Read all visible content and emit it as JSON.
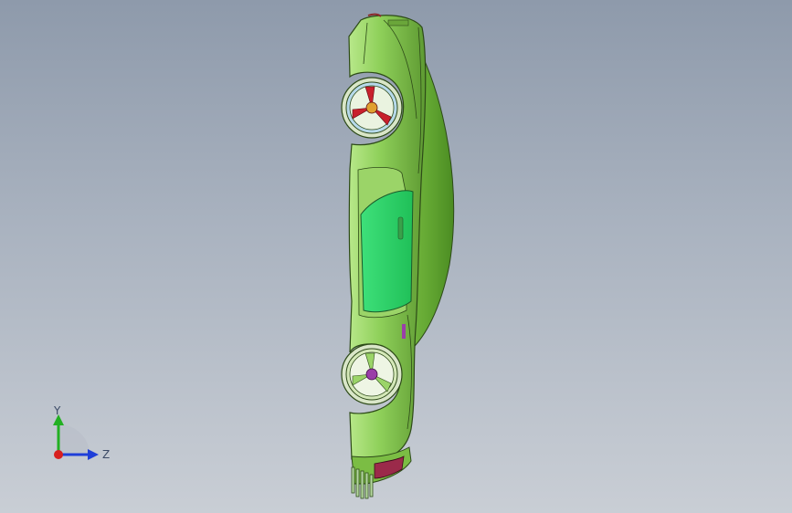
{
  "viewport": {
    "background_top": "#8e9aab",
    "background_bottom": "#c9ced5"
  },
  "model": {
    "body_color": "#8fd05a",
    "body_shadow_color": "#5e9a32",
    "window_color": "#2fd66a",
    "wheel_hub_front_color": "#c8202c",
    "wheel_hub_rear_color": "#9a3fa8",
    "tail_light_color": "#9b2a4a"
  },
  "triad": {
    "y_label": "Y",
    "z_label": "Z",
    "y_color": "#22b022",
    "z_color": "#1f3fd8",
    "x_color": "#d81f1f"
  }
}
